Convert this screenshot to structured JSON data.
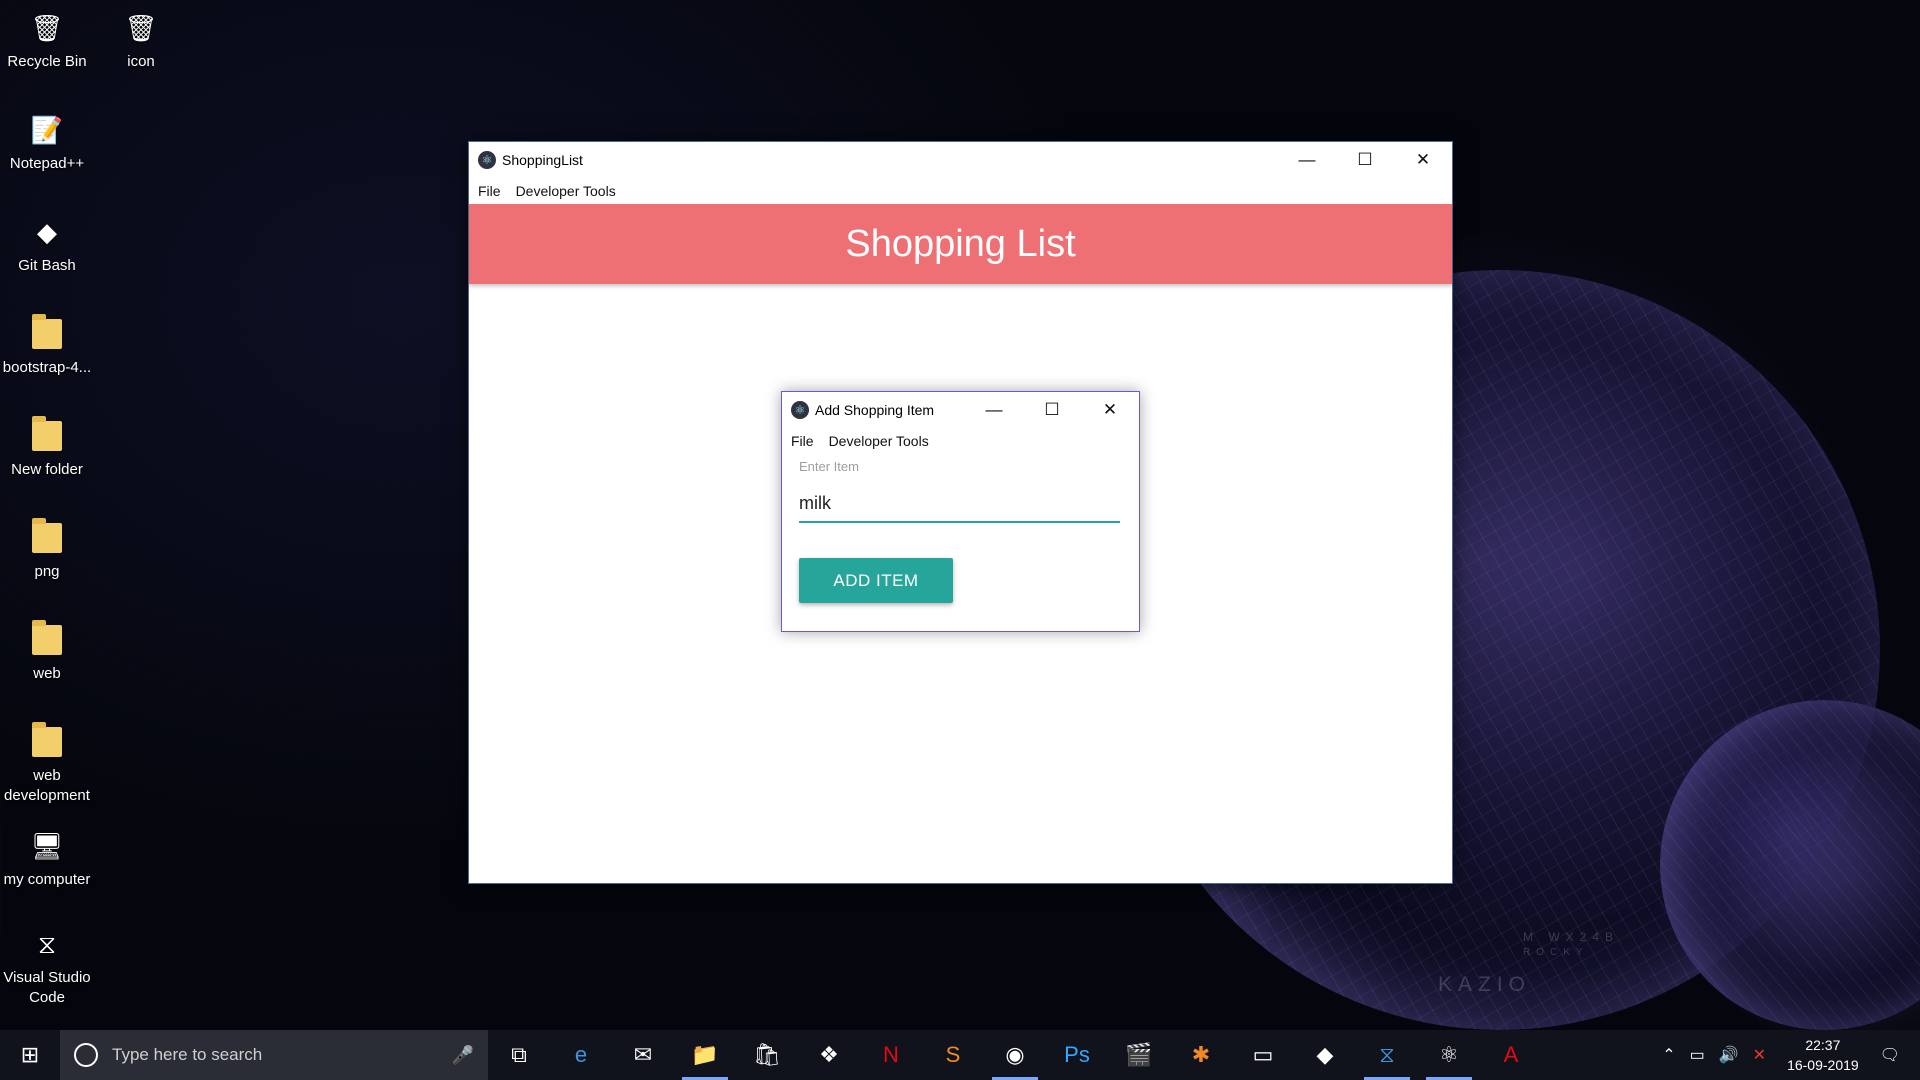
{
  "desktop": {
    "icons": [
      {
        "label": "Recycle Bin",
        "glyph": "🗑"
      },
      {
        "label": "icon",
        "glyph": "🗑"
      },
      {
        "label": "Notepad++",
        "glyph": "📝"
      },
      {
        "label": "Git Bash",
        "glyph": "◆"
      },
      {
        "label": "bootstrap-4...",
        "glyph": "folder"
      },
      {
        "label": "New folder",
        "glyph": "folder"
      },
      {
        "label": "png",
        "glyph": "folder"
      },
      {
        "label": "web",
        "glyph": "folder"
      },
      {
        "label": "web development",
        "glyph": "folder"
      },
      {
        "label": "my computer",
        "glyph": "🖥"
      },
      {
        "label": "Visual Studio Code",
        "glyph": "⧖"
      }
    ],
    "watermark_1": "M WX24B",
    "watermark_2": "ROCKY",
    "watermark_3": "KAZIO"
  },
  "main_window": {
    "title": "ShoppingList",
    "menu": [
      "File",
      "Developer Tools"
    ],
    "header": "Shopping List",
    "controls": {
      "minimize": "—",
      "maximize": "☐",
      "close": "✕"
    }
  },
  "dialog": {
    "title": "Add Shopping Item",
    "menu": [
      "File",
      "Developer Tools"
    ],
    "field_label": "Enter Item",
    "field_value": "milk",
    "button": "ADD ITEM",
    "controls": {
      "minimize": "—",
      "maximize": "☐",
      "close": "✕"
    }
  },
  "taskbar": {
    "search_placeholder": "Type here to search",
    "apps": [
      {
        "name": "task-view",
        "glyph": "⧉"
      },
      {
        "name": "edge",
        "glyph": "e"
      },
      {
        "name": "mail",
        "glyph": "✉"
      },
      {
        "name": "file-explorer",
        "glyph": "📁"
      },
      {
        "name": "store",
        "glyph": "🛍"
      },
      {
        "name": "dropbox",
        "glyph": "❖"
      },
      {
        "name": "netflix",
        "glyph": "N"
      },
      {
        "name": "sublime",
        "glyph": "S"
      },
      {
        "name": "chrome",
        "glyph": "◉"
      },
      {
        "name": "photoshop",
        "glyph": "Ps"
      },
      {
        "name": "video",
        "glyph": "🎬"
      },
      {
        "name": "xampp",
        "glyph": "✱"
      },
      {
        "name": "terminal",
        "glyph": "▭"
      },
      {
        "name": "git",
        "glyph": "◆"
      },
      {
        "name": "vscode",
        "glyph": "⧖"
      },
      {
        "name": "electron",
        "glyph": "⚛"
      },
      {
        "name": "acrobat",
        "glyph": "A"
      }
    ],
    "time": "22:37",
    "date": "16-09-2019"
  },
  "colors": {
    "header": "#ef7074",
    "accent": "#26a69a"
  }
}
